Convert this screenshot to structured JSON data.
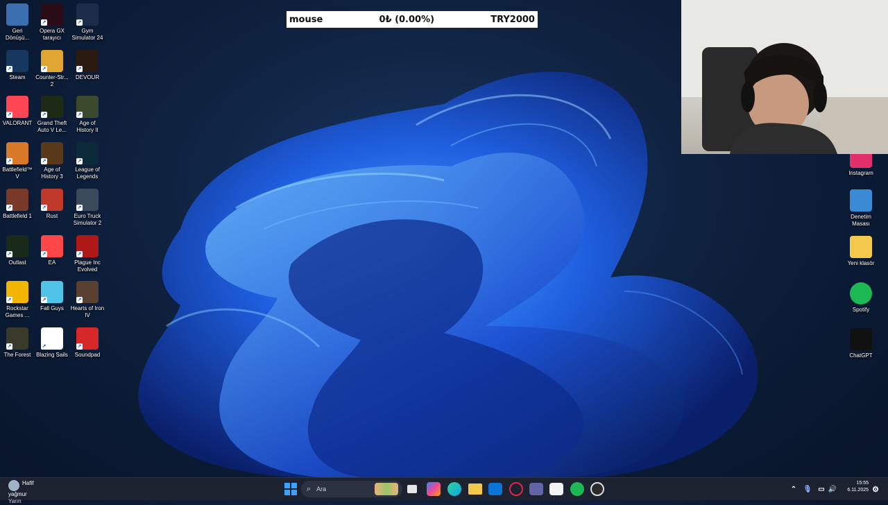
{
  "overlay": {
    "label": "mouse",
    "amount": "0₺ (0.00%)",
    "goal": "TRY2000"
  },
  "desktop_left": [
    {
      "label": "Geri Dönüşü...",
      "icon": "recycle-bin-icon",
      "color": "#3b6fb0"
    },
    {
      "label": "Opera GX tarayıcı",
      "icon": "opera-gx-icon",
      "color": "#2a0b16"
    },
    {
      "label": "Gym Simulator 24",
      "icon": "gym-simulator-icon",
      "color": "#1b2b4a"
    },
    {
      "label": "Steam",
      "icon": "steam-icon",
      "color": "#16385e"
    },
    {
      "label": "Counter-Str... 2",
      "icon": "counter-strike-icon",
      "color": "#e1a531"
    },
    {
      "label": "DEVOUR",
      "icon": "devour-icon",
      "color": "#2b1a10"
    },
    {
      "label": "VALORANT",
      "icon": "valorant-icon",
      "color": "#ff4655"
    },
    {
      "label": "Grand Theft Auto V Le...",
      "icon": "gta-v-icon",
      "color": "#1d2b16"
    },
    {
      "label": "Age of History II",
      "icon": "age-of-history-2-icon",
      "color": "#3b4a2c"
    },
    {
      "label": "Battlefield™ V",
      "icon": "battlefield-v-icon",
      "color": "#d9792a"
    },
    {
      "label": "Age of History 3",
      "icon": "age-of-history-3-icon",
      "color": "#5a3a1a"
    },
    {
      "label": "League of Legends",
      "icon": "league-of-legends-icon",
      "color": "#0b2a3a"
    },
    {
      "label": "Battlefield 1",
      "icon": "battlefield-1-icon",
      "color": "#7a3a2a"
    },
    {
      "label": "Rust",
      "icon": "rust-icon",
      "color": "#c0392b"
    },
    {
      "label": "Euro Truck Simulator 2",
      "icon": "euro-truck-icon",
      "color": "#3a4a5a"
    },
    {
      "label": "Outlast",
      "icon": "outlast-icon",
      "color": "#1a2a1a"
    },
    {
      "label": "EA",
      "icon": "ea-icon",
      "color": "#ff4747"
    },
    {
      "label": "Plague Inc Evolved",
      "icon": "plague-inc-icon",
      "color": "#b01818"
    },
    {
      "label": "Rockstar Games ...",
      "icon": "rockstar-icon",
      "color": "#f2b600"
    },
    {
      "label": "Fall Guys",
      "icon": "fall-guys-icon",
      "color": "#4fc3e8"
    },
    {
      "label": "Hearts of Iron IV",
      "icon": "hearts-of-iron-icon",
      "color": "#5a4030"
    },
    {
      "label": "The Forest",
      "icon": "the-forest-icon",
      "color": "#3a3a2a"
    },
    {
      "label": "Blazing Sails",
      "icon": "blazing-sails-icon",
      "color": "#ffffff"
    },
    {
      "label": "Soundpad",
      "icon": "soundpad-icon",
      "color": "#d62828"
    }
  ],
  "desktop_right": [
    {
      "label": "Instagram",
      "icon": "instagram-icon",
      "color": "#e1306c"
    },
    {
      "label": "Denetim Masası",
      "icon": "control-panel-icon",
      "color": "#3a8ad6"
    },
    {
      "label": "Yeni klasör",
      "icon": "folder-icon",
      "color": "#f2c94c"
    },
    {
      "label": "Spotify",
      "icon": "spotify-icon",
      "color": "#1db954"
    },
    {
      "label": "ChatGPT",
      "icon": "chatgpt-icon",
      "color": "#111111"
    }
  ],
  "taskbar": {
    "search_placeholder": "Ara",
    "weather_temp_label": "Hafif yağmur",
    "weather_sub": "Yarın",
    "time": "15:55",
    "date": "6.11.2025"
  }
}
